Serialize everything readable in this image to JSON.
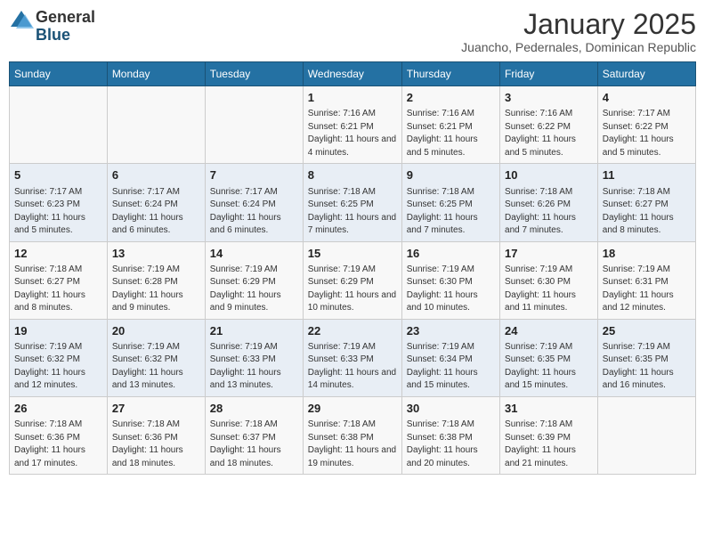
{
  "logo": {
    "general": "General",
    "blue": "Blue"
  },
  "title": "January 2025",
  "location": "Juancho, Pedernales, Dominican Republic",
  "days_of_week": [
    "Sunday",
    "Monday",
    "Tuesday",
    "Wednesday",
    "Thursday",
    "Friday",
    "Saturday"
  ],
  "weeks": [
    [
      {
        "day": "",
        "content": ""
      },
      {
        "day": "",
        "content": ""
      },
      {
        "day": "",
        "content": ""
      },
      {
        "day": "1",
        "content": "Sunrise: 7:16 AM\nSunset: 6:21 PM\nDaylight: 11 hours and 4 minutes."
      },
      {
        "day": "2",
        "content": "Sunrise: 7:16 AM\nSunset: 6:21 PM\nDaylight: 11 hours and 5 minutes."
      },
      {
        "day": "3",
        "content": "Sunrise: 7:16 AM\nSunset: 6:22 PM\nDaylight: 11 hours and 5 minutes."
      },
      {
        "day": "4",
        "content": "Sunrise: 7:17 AM\nSunset: 6:22 PM\nDaylight: 11 hours and 5 minutes."
      }
    ],
    [
      {
        "day": "5",
        "content": "Sunrise: 7:17 AM\nSunset: 6:23 PM\nDaylight: 11 hours and 5 minutes."
      },
      {
        "day": "6",
        "content": "Sunrise: 7:17 AM\nSunset: 6:24 PM\nDaylight: 11 hours and 6 minutes."
      },
      {
        "day": "7",
        "content": "Sunrise: 7:17 AM\nSunset: 6:24 PM\nDaylight: 11 hours and 6 minutes."
      },
      {
        "day": "8",
        "content": "Sunrise: 7:18 AM\nSunset: 6:25 PM\nDaylight: 11 hours and 7 minutes."
      },
      {
        "day": "9",
        "content": "Sunrise: 7:18 AM\nSunset: 6:25 PM\nDaylight: 11 hours and 7 minutes."
      },
      {
        "day": "10",
        "content": "Sunrise: 7:18 AM\nSunset: 6:26 PM\nDaylight: 11 hours and 7 minutes."
      },
      {
        "day": "11",
        "content": "Sunrise: 7:18 AM\nSunset: 6:27 PM\nDaylight: 11 hours and 8 minutes."
      }
    ],
    [
      {
        "day": "12",
        "content": "Sunrise: 7:18 AM\nSunset: 6:27 PM\nDaylight: 11 hours and 8 minutes."
      },
      {
        "day": "13",
        "content": "Sunrise: 7:19 AM\nSunset: 6:28 PM\nDaylight: 11 hours and 9 minutes."
      },
      {
        "day": "14",
        "content": "Sunrise: 7:19 AM\nSunset: 6:29 PM\nDaylight: 11 hours and 9 minutes."
      },
      {
        "day": "15",
        "content": "Sunrise: 7:19 AM\nSunset: 6:29 PM\nDaylight: 11 hours and 10 minutes."
      },
      {
        "day": "16",
        "content": "Sunrise: 7:19 AM\nSunset: 6:30 PM\nDaylight: 11 hours and 10 minutes."
      },
      {
        "day": "17",
        "content": "Sunrise: 7:19 AM\nSunset: 6:30 PM\nDaylight: 11 hours and 11 minutes."
      },
      {
        "day": "18",
        "content": "Sunrise: 7:19 AM\nSunset: 6:31 PM\nDaylight: 11 hours and 12 minutes."
      }
    ],
    [
      {
        "day": "19",
        "content": "Sunrise: 7:19 AM\nSunset: 6:32 PM\nDaylight: 11 hours and 12 minutes."
      },
      {
        "day": "20",
        "content": "Sunrise: 7:19 AM\nSunset: 6:32 PM\nDaylight: 11 hours and 13 minutes."
      },
      {
        "day": "21",
        "content": "Sunrise: 7:19 AM\nSunset: 6:33 PM\nDaylight: 11 hours and 13 minutes."
      },
      {
        "day": "22",
        "content": "Sunrise: 7:19 AM\nSunset: 6:33 PM\nDaylight: 11 hours and 14 minutes."
      },
      {
        "day": "23",
        "content": "Sunrise: 7:19 AM\nSunset: 6:34 PM\nDaylight: 11 hours and 15 minutes."
      },
      {
        "day": "24",
        "content": "Sunrise: 7:19 AM\nSunset: 6:35 PM\nDaylight: 11 hours and 15 minutes."
      },
      {
        "day": "25",
        "content": "Sunrise: 7:19 AM\nSunset: 6:35 PM\nDaylight: 11 hours and 16 minutes."
      }
    ],
    [
      {
        "day": "26",
        "content": "Sunrise: 7:18 AM\nSunset: 6:36 PM\nDaylight: 11 hours and 17 minutes."
      },
      {
        "day": "27",
        "content": "Sunrise: 7:18 AM\nSunset: 6:36 PM\nDaylight: 11 hours and 18 minutes."
      },
      {
        "day": "28",
        "content": "Sunrise: 7:18 AM\nSunset: 6:37 PM\nDaylight: 11 hours and 18 minutes."
      },
      {
        "day": "29",
        "content": "Sunrise: 7:18 AM\nSunset: 6:38 PM\nDaylight: 11 hours and 19 minutes."
      },
      {
        "day": "30",
        "content": "Sunrise: 7:18 AM\nSunset: 6:38 PM\nDaylight: 11 hours and 20 minutes."
      },
      {
        "day": "31",
        "content": "Sunrise: 7:18 AM\nSunset: 6:39 PM\nDaylight: 11 hours and 21 minutes."
      },
      {
        "day": "",
        "content": ""
      }
    ]
  ]
}
